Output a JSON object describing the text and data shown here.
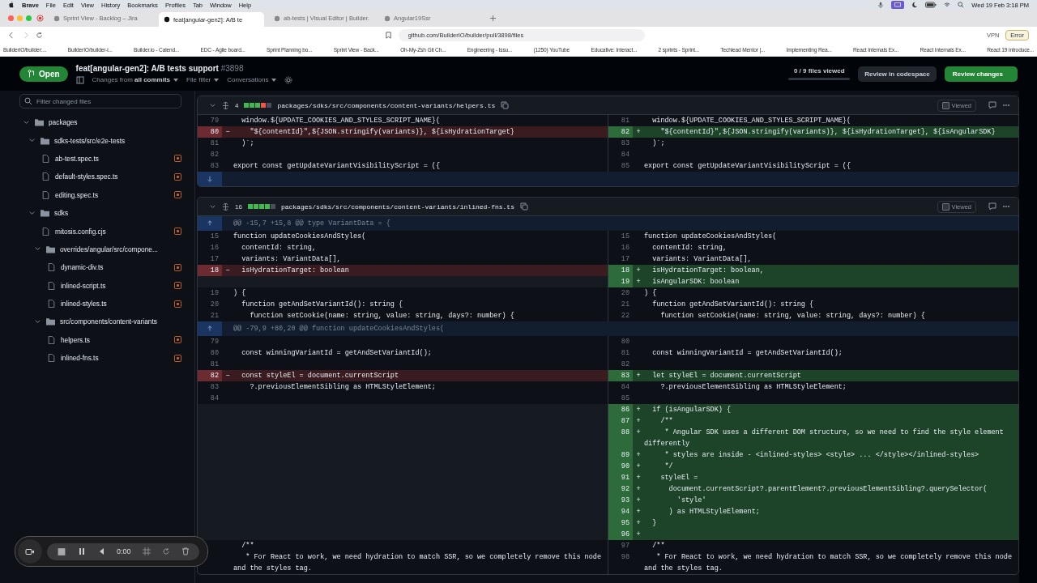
{
  "menubar": {
    "app": "Brave",
    "menus": [
      "File",
      "Edit",
      "View",
      "History",
      "Bookmarks",
      "Profiles",
      "Tab",
      "Window",
      "Help"
    ],
    "clock": "Wed 19 Feb 3:18 PM"
  },
  "tabs": [
    {
      "title": "Sprint View - Backlog – Jira",
      "selected": false
    },
    {
      "title": "feat[angular-gen2]: A/B te",
      "selected": true
    },
    {
      "title": "ab-tests | Visual Editor | Builder.",
      "selected": false
    },
    {
      "title": "Angular19Ssr",
      "selected": false
    }
  ],
  "address": {
    "url": "github.com/BuilderIO/builder/pull/3898/files",
    "vpn": "VPN",
    "error": "Error"
  },
  "bookmarks": [
    "BuilderIO/builder:...",
    "BuilderIO/builder-i...",
    "Builder.io - Calend...",
    "EDC - Agile board...",
    "Sprint Planning bo...",
    "Sprint View - Back...",
    "Oh-My-Zsh Git Ch...",
    "Engineering - Issu...",
    "(1250) YouTube",
    "Educative: Interact...",
    "2 sprints - Sprint...",
    "Techlead Mentor |...",
    "Implementing Rea...",
    "React Internals Ex...",
    "React Internals Ex...",
    "React 19 introduce..."
  ],
  "pr": {
    "state": "Open",
    "title": "feat[angular-gen2]: A/B tests support",
    "number": "#3898",
    "changes_label": "Changes from",
    "changes_value": "all commits",
    "file_filter": "File filter",
    "conversations": "Conversations",
    "files_viewed": "0 / 9 files viewed",
    "codespace": "Review in codespace",
    "review": "Review changes"
  },
  "sidebar": {
    "placeholder": "Filter changed files",
    "tree": [
      {
        "kind": "folder",
        "name": "packages",
        "expanded": true,
        "children": [
          {
            "kind": "folder",
            "name": "sdks-tests/src/e2e-tests",
            "expanded": true,
            "children": [
              {
                "kind": "file",
                "name": "ab-test.spec.ts"
              },
              {
                "kind": "file",
                "name": "default-styles.spec.ts"
              },
              {
                "kind": "file",
                "name": "editing.spec.ts"
              }
            ]
          },
          {
            "kind": "folder",
            "name": "sdks",
            "expanded": true,
            "children": [
              {
                "kind": "file",
                "name": "mitosis.config.cjs"
              },
              {
                "kind": "folder",
                "name": "overrides/angular/src/compone...",
                "expanded": true,
                "children": [
                  {
                    "kind": "file",
                    "name": "dynamic-div.ts"
                  },
                  {
                    "kind": "file",
                    "name": "inlined-script.ts"
                  },
                  {
                    "kind": "file",
                    "name": "inlined-styles.ts"
                  }
                ]
              },
              {
                "kind": "folder",
                "name": "src/components/content-variants",
                "expanded": true,
                "children": [
                  {
                    "kind": "file",
                    "name": "helpers.ts"
                  },
                  {
                    "kind": "file",
                    "name": "inlined-fns.ts"
                  }
                ]
              }
            ]
          }
        ]
      }
    ]
  },
  "files": [
    {
      "count": "4",
      "diffstat": [
        {
          "kind": "add"
        },
        {
          "kind": "add"
        },
        {
          "kind": "add"
        },
        {
          "kind": "del"
        },
        {
          "kind": "neutral"
        }
      ],
      "path": "packages/sdks/src/components/content-variants/helpers.ts",
      "viewed": false,
      "viewed_label": "Viewed",
      "rows": [
        {
          "kind": "code",
          "l": {
            "n": "79",
            "t": "  window.${UPDATE_COOKIES_AND_STYLES_SCRIPT_NAME}(",
            "kind": "ctx"
          },
          "r": {
            "n": "81",
            "t": "  window.${UPDATE_COOKIES_AND_STYLES_SCRIPT_NAME}(",
            "kind": "ctx"
          }
        },
        {
          "kind": "code",
          "l": {
            "n": "80",
            "s": "−",
            "t": "    \"${contentId}\",${JSON.stringify(variants)}, ${isHydrationTarget}",
            "kind": "del"
          },
          "r": {
            "n": "82",
            "s": "+",
            "t": "    \"${contentId}\",${JSON.stringify(variants)}, ${isHydrationTarget}, ${isAngularSDK}",
            "kind": "add"
          }
        },
        {
          "kind": "code",
          "l": {
            "n": "81",
            "t": "  )`;",
            "kind": "ctx"
          },
          "r": {
            "n": "83",
            "t": "  )`;",
            "kind": "ctx"
          }
        },
        {
          "kind": "code",
          "l": {
            "n": "82",
            "kind": "ctx"
          },
          "r": {
            "n": "84",
            "kind": "ctx"
          }
        },
        {
          "kind": "code",
          "l": {
            "n": "83",
            "t": "export const getUpdateVariantVisibilityScript = ({",
            "kind": "ctx"
          },
          "r": {
            "n": "85",
            "t": "export const getUpdateVariantVisibilityScript = ({",
            "kind": "ctx"
          }
        },
        {
          "kind": "expand"
        }
      ]
    },
    {
      "count": "16",
      "diffstat": [
        {
          "kind": "add"
        },
        {
          "kind": "add"
        },
        {
          "kind": "add"
        },
        {
          "kind": "add"
        },
        {
          "kind": "neutral"
        }
      ],
      "path": "packages/sdks/src/components/content-variants/inlined-fns.ts",
      "viewed": false,
      "viewed_label": "Viewed",
      "rows": [
        {
          "kind": "hunk",
          "t": "@@ -15,7 +15,8 @@ type VariantData = {"
        },
        {
          "kind": "code",
          "l": {
            "n": "15",
            "t": "function updateCookiesAndStyles(",
            "kind": "ctx"
          },
          "r": {
            "n": "15",
            "t": "function updateCookiesAndStyles(",
            "kind": "ctx"
          }
        },
        {
          "kind": "code",
          "l": {
            "n": "16",
            "t": "  contentId: string,",
            "kind": "ctx"
          },
          "r": {
            "n": "16",
            "t": "  contentId: string,",
            "kind": "ctx"
          }
        },
        {
          "kind": "code",
          "l": {
            "n": "17",
            "t": "  variants: VariantData[],",
            "kind": "ctx"
          },
          "r": {
            "n": "17",
            "t": "  variants: VariantData[],",
            "kind": "ctx"
          }
        },
        {
          "kind": "code",
          "l": {
            "n": "18",
            "s": "−",
            "t": "  isHydrationTarget: boolean",
            "kind": "del"
          },
          "r": {
            "n": "18",
            "s": "+",
            "t": "  isHydrationTarget: boolean,",
            "kind": "add"
          }
        },
        {
          "kind": "code",
          "l": {
            "kind": "empty"
          },
          "r": {
            "n": "19",
            "s": "+",
            "t": "  isAngularSDK: boolean",
            "kind": "add"
          }
        },
        {
          "kind": "code",
          "l": {
            "n": "19",
            "t": ") {",
            "kind": "ctx"
          },
          "r": {
            "n": "20",
            "t": ") {",
            "kind": "ctx"
          }
        },
        {
          "kind": "code",
          "l": {
            "n": "20",
            "t": "  function getAndSetVariantId(): string {",
            "kind": "ctx"
          },
          "r": {
            "n": "21",
            "t": "  function getAndSetVariantId(): string {",
            "kind": "ctx"
          }
        },
        {
          "kind": "code",
          "l": {
            "n": "21",
            "t": "    function setCookie(name: string, value: string, days?: number) {",
            "kind": "ctx"
          },
          "r": {
            "n": "22",
            "t": "    function setCookie(name: string, value: string, days?: number) {",
            "kind": "ctx"
          }
        },
        {
          "kind": "hunk",
          "t": "@@ -79,9 +80,20 @@ function updateCookiesAndStyles("
        },
        {
          "kind": "code",
          "l": {
            "n": "79",
            "kind": "ctx"
          },
          "r": {
            "n": "80",
            "kind": "ctx"
          }
        },
        {
          "kind": "code",
          "l": {
            "n": "80",
            "t": "  const winningVariantId = getAndSetVariantId();",
            "kind": "ctx"
          },
          "r": {
            "n": "81",
            "t": "  const winningVariantId = getAndSetVariantId();",
            "kind": "ctx"
          }
        },
        {
          "kind": "code",
          "l": {
            "n": "81",
            "kind": "ctx"
          },
          "r": {
            "n": "82",
            "kind": "ctx"
          }
        },
        {
          "kind": "code",
          "l": {
            "n": "82",
            "s": "−",
            "t": "  const styleEl = document.currentScript",
            "kind": "del"
          },
          "r": {
            "n": "83",
            "s": "+",
            "t": "  let styleEl = document.currentScript",
            "kind": "add"
          }
        },
        {
          "kind": "code",
          "l": {
            "n": "83",
            "t": "    ?.previousElementSibling as HTMLStyleElement;",
            "kind": "ctx"
          },
          "r": {
            "n": "84",
            "t": "    ?.previousElementSibling as HTMLStyleElement;",
            "kind": "ctx"
          }
        },
        {
          "kind": "code",
          "l": {
            "n": "84",
            "kind": "ctx"
          },
          "r": {
            "n": "85",
            "kind": "ctx"
          }
        },
        {
          "kind": "code",
          "l": {
            "kind": "empty"
          },
          "r": {
            "n": "86",
            "s": "+",
            "t": "  if (isAngularSDK) {",
            "kind": "add"
          }
        },
        {
          "kind": "code",
          "l": {
            "kind": "empty"
          },
          "r": {
            "n": "87",
            "s": "+",
            "t": "    /**",
            "kind": "add"
          }
        },
        {
          "kind": "code",
          "l": {
            "kind": "empty"
          },
          "r": {
            "n": "88",
            "s": "+",
            "t": "     * Angular SDK uses a different DOM structure, so we need to find the style element differently",
            "kind": "add"
          }
        },
        {
          "kind": "code",
          "l": {
            "kind": "empty"
          },
          "r": {
            "n": "89",
            "s": "+",
            "t": "     * styles are inside - <inlined-styles> <style> ... </style></inlined-styles>",
            "kind": "add"
          }
        },
        {
          "kind": "code",
          "l": {
            "kind": "empty"
          },
          "r": {
            "n": "90",
            "s": "+",
            "t": "     */",
            "kind": "add"
          }
        },
        {
          "kind": "code",
          "l": {
            "kind": "empty"
          },
          "r": {
            "n": "91",
            "s": "+",
            "t": "    styleEl =",
            "kind": "add"
          }
        },
        {
          "kind": "code",
          "l": {
            "kind": "empty"
          },
          "r": {
            "n": "92",
            "s": "+",
            "t": "      document.currentScript?.parentElement?.previousElementSibling?.querySelector(",
            "kind": "add"
          }
        },
        {
          "kind": "code",
          "l": {
            "kind": "empty"
          },
          "r": {
            "n": "93",
            "s": "+",
            "t": "        'style'",
            "kind": "add"
          }
        },
        {
          "kind": "code",
          "l": {
            "kind": "empty"
          },
          "r": {
            "n": "94",
            "s": "+",
            "t": "      ) as HTMLStyleElement;",
            "kind": "add"
          }
        },
        {
          "kind": "code",
          "l": {
            "kind": "empty"
          },
          "r": {
            "n": "95",
            "s": "+",
            "t": "  }",
            "kind": "add"
          }
        },
        {
          "kind": "code",
          "l": {
            "kind": "empty"
          },
          "r": {
            "n": "96",
            "s": "+",
            "kind": "add"
          }
        },
        {
          "kind": "code",
          "l": {
            "t": "  /**",
            "kind": "ctx"
          },
          "r": {
            "n": "97",
            "t": "  /**",
            "kind": "ctx"
          }
        },
        {
          "kind": "code",
          "l": {
            "t": "   * For React to work, we need hydration to match SSR, so we completely remove this node and the styles tag.",
            "kind": "ctx"
          },
          "r": {
            "n": "98",
            "t": "   * For React to work, we need hydration to match SSR, so we completely remove this node and the styles tag.",
            "kind": "ctx"
          }
        }
      ]
    }
  ],
  "recorder": {
    "time": "0:00"
  }
}
